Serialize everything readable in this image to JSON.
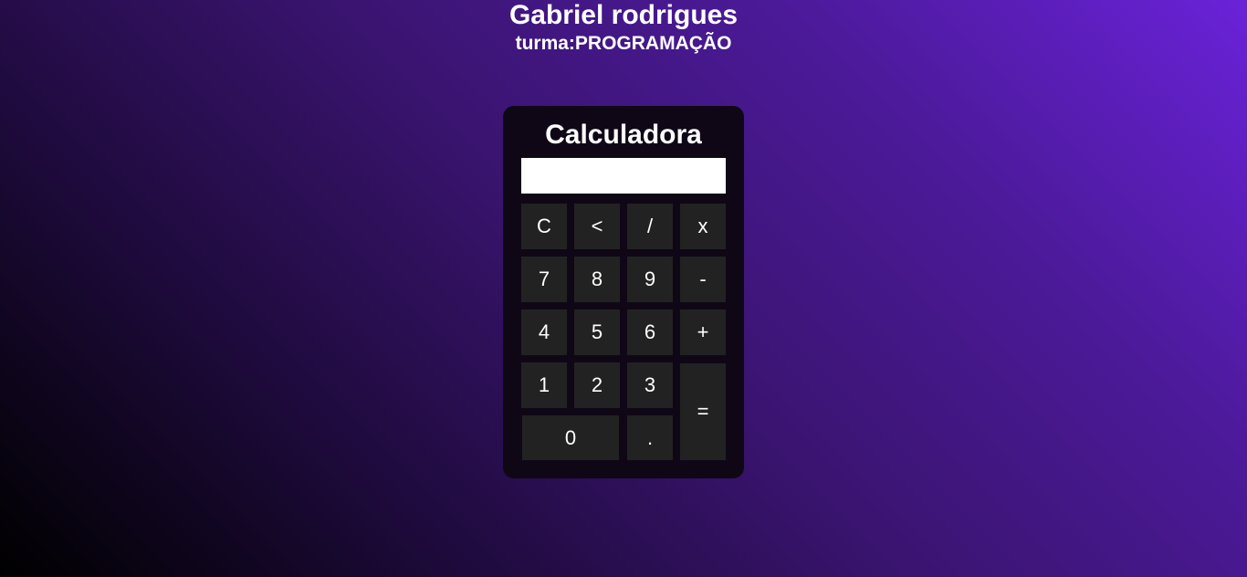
{
  "header": {
    "name": "Gabriel rodrigues",
    "class_label": "turma:PROGRAMAÇÃO"
  },
  "calculator": {
    "title": "Calculadora",
    "display_value": "",
    "buttons": {
      "clear": "C",
      "backspace": "<",
      "divide": "/",
      "multiply": "x",
      "seven": "7",
      "eight": "8",
      "nine": "9",
      "minus": "-",
      "four": "4",
      "five": "5",
      "six": "6",
      "plus": "+",
      "one": "1",
      "two": "2",
      "three": "3",
      "equals": "=",
      "zero": "0",
      "decimal": "."
    }
  },
  "colors": {
    "panel": "#0f0716",
    "button": "#222222",
    "gradient_dark": "#000000",
    "gradient_light": "#6a22d8"
  }
}
